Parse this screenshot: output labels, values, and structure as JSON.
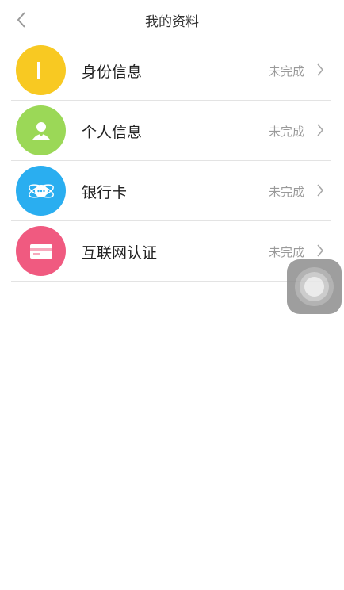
{
  "header": {
    "title": "我的资料",
    "back_icon": "chevron-left-icon"
  },
  "rows": [
    {
      "label": "身份信息",
      "status": "未完成",
      "icon": "id-card-icon",
      "color": "#f8c922"
    },
    {
      "label": "个人信息",
      "status": "未完成",
      "icon": "person-icon",
      "color": "#9bd857"
    },
    {
      "label": "银行卡",
      "status": "未完成",
      "icon": "planet-chat-icon",
      "color": "#2aaef0"
    },
    {
      "label": "互联网认证",
      "status": "未完成",
      "icon": "card-icon",
      "color": "#f05a80"
    }
  ],
  "chevron_icon": "chevron-right-icon",
  "assistive_touch_icon": "assistive-touch-icon"
}
